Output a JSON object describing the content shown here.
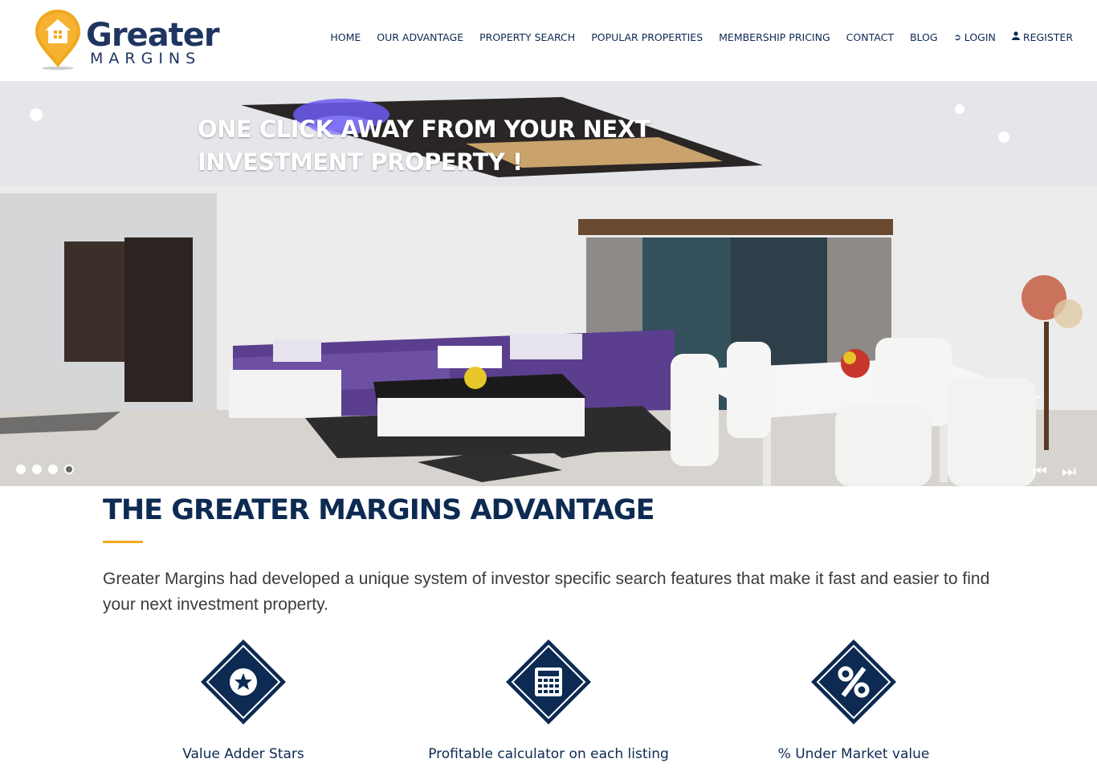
{
  "brand": {
    "name": "Greater",
    "tagline": "MARGINS",
    "colors": {
      "navy": "#0d2a52",
      "orange": "#f0a81c"
    }
  },
  "nav": {
    "items": [
      {
        "label": "HOME"
      },
      {
        "label": "OUR ADVANTAGE"
      },
      {
        "label": "PROPERTY SEARCH"
      },
      {
        "label": "POPULAR PROPERTIES"
      },
      {
        "label": "MEMBERSHIP PRICING"
      },
      {
        "label": "CONTACT"
      },
      {
        "label": "BLOG"
      },
      {
        "label": "LOGIN",
        "icon": "sign-in-icon"
      },
      {
        "label": "REGISTER",
        "icon": "user-icon"
      }
    ]
  },
  "hero": {
    "title": "ONE CLICK AWAY FROM YOUR NEXT INVESTMENT PROPERTY !",
    "slides": 4,
    "active_slide": 4
  },
  "advantage": {
    "title": "THE GREATER MARGINS ADVANTAGE",
    "intro": "Greater Margins had developed a unique system of investor specific search features that make it fast and easier to find your next investment property.",
    "features": [
      {
        "label": "Value Adder Stars",
        "icon": "star-icon"
      },
      {
        "label": "Profitable calculator on each listing",
        "icon": "calculator-icon"
      },
      {
        "label": "% Under Market value",
        "icon": "percent-icon"
      }
    ]
  }
}
